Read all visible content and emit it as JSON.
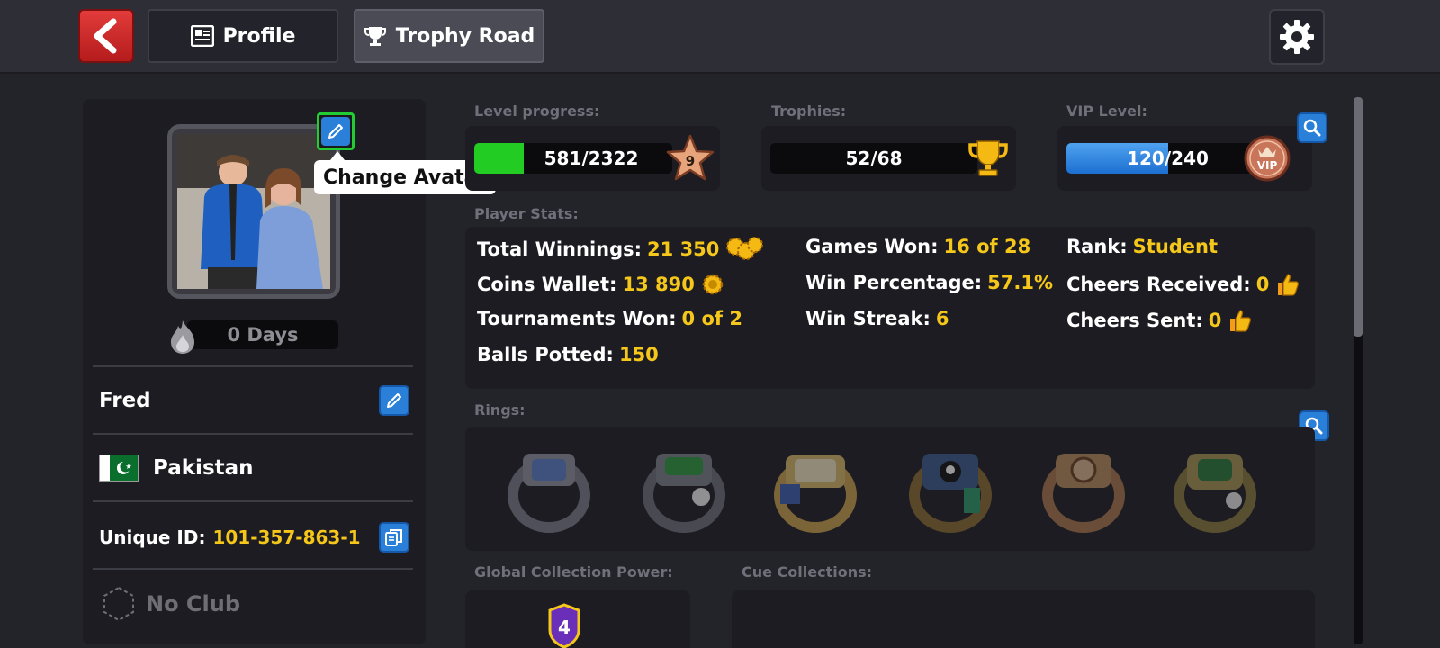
{
  "topbar": {
    "tabs": [
      {
        "label": "Profile",
        "icon": "profile-card-icon",
        "active": false
      },
      {
        "label": "Trophy Road",
        "icon": "trophy-icon",
        "active": true
      }
    ]
  },
  "profile": {
    "tooltip": "Change Avatar",
    "streak": "0 Days",
    "name": "Fred",
    "country": "Pakistan",
    "unique_id_label": "Unique ID:",
    "unique_id": "101-357-863-1",
    "club": "No Club"
  },
  "progress": {
    "level": {
      "label": "Level progress:",
      "text": "581/2322",
      "value": 581,
      "max": 2322,
      "level": "9"
    },
    "trophies": {
      "label": "Trophies:",
      "text": "52/68",
      "value": 52,
      "max": 68
    },
    "vip": {
      "label": "VIP Level:",
      "text": "120/240",
      "value": 120,
      "max": 240,
      "badge": "VIP"
    }
  },
  "player_stats": {
    "label": "Player Stats:",
    "total_winnings": {
      "label": "Total Winnings:",
      "value": "21 350"
    },
    "coins_wallet": {
      "label": "Coins Wallet:",
      "value": "13 890"
    },
    "tournaments_won": {
      "label": "Tournaments Won:",
      "value": "0 of 2"
    },
    "balls_potted": {
      "label": "Balls Potted:",
      "value": "150"
    },
    "games_won": {
      "label": "Games Won:",
      "value": "16 of 28"
    },
    "win_percentage": {
      "label": "Win Percentage:",
      "value": "57.1%"
    },
    "win_streak": {
      "label": "Win Streak:",
      "value": "6"
    },
    "rank": {
      "label": "Rank:",
      "value": "Student"
    },
    "cheers_received": {
      "label": "Cheers Received:",
      "value": "0"
    },
    "cheers_sent": {
      "label": "Cheers Sent:",
      "value": "0"
    }
  },
  "rings": {
    "label": "Rings:",
    "items": [
      "ring-1",
      "ring-2",
      "ring-3",
      "ring-4",
      "ring-5",
      "ring-6"
    ]
  },
  "collection": {
    "global_power_label": "Global Collection Power:",
    "global_power_value": "4",
    "cue_collections_label": "Cue Collections:"
  },
  "colors": {
    "accent_gold": "#f5c71a",
    "level_green": "#22cc22",
    "vip_blue": "#2a7fd8",
    "back_red": "#d42a2a"
  }
}
